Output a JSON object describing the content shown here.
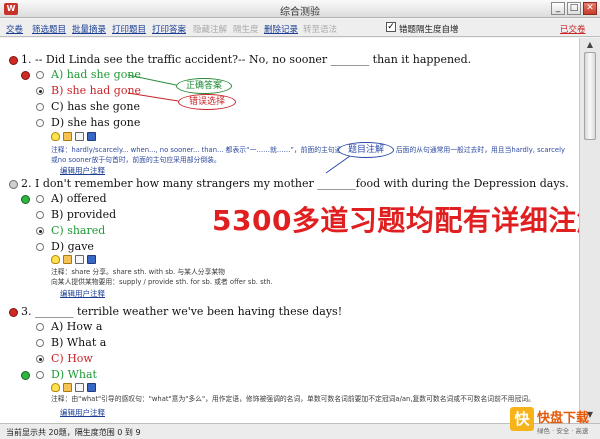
{
  "window": {
    "title": "综合测验",
    "app_icon": "W",
    "minimize": "_",
    "maximize": "□",
    "close": "✕"
  },
  "toolbar": {
    "items": [
      "交卷",
      "筛选题目",
      "批量摘录",
      "打印题目",
      "打印答案",
      "隐藏注解",
      "隔生度",
      "删除记录",
      "转至语法"
    ],
    "checkbox_label": "错题隔生度自增",
    "checkbox_mark": "✓",
    "exit": "已交卷"
  },
  "question1": {
    "text": "1. -- Did Linda see the traffic accident?-- No, no sooner _______ than it happened.",
    "options": [
      "A) had she gone",
      "B) she had gone",
      "C) has she gone",
      "D) she has gone"
    ],
    "note": "注释：hardly/scarcely... when..., no sooner... than... 都表示“一……就……”，前面的主句通常用过去完成时，后面的从句通常用一般过去时，用且当hardly, scarcely或no sooner放于句首时，前面的主句应采用部分倒装。",
    "edit_link": "编辑用户注释",
    "bubble_correct": "正确答案",
    "bubble_wrong": "错误选择",
    "bubble_note": "题目注解"
  },
  "question2": {
    "text": "2.  I don't remember how many strangers my mother _______food with during the Depression days.",
    "options": [
      "A) offered",
      "B) provided",
      "C) shared",
      "D) gave"
    ],
    "note1": "注释：share 分享。share sth. with sb. 与某人分享某物",
    "note2": "向某人提供某物要用：supply / provide sth. for sb. 或者  offer sb. sth.",
    "edit_link": "编辑用户注释"
  },
  "question3": {
    "text": "3.  _______ terrible weather we've been having these days!",
    "options": [
      "A) How a",
      "B) What a",
      "C) How",
      "D) What"
    ],
    "note": "注释：由\"what\"引导的感叹句：\"what\"意为\"多么\"，用作定语，修饰被强调的名词，单数可数名词前要加不定冠词a/an,复数可数名词或不可数名词前不用冠词。",
    "edit_link": "编辑用户注释"
  },
  "banner": "5300多道习题均配有详细注解！",
  "status": "当前显示共 20题，隔生度范围 0 到 9",
  "watermark": {
    "logo": "快",
    "name": "快盘下载",
    "tagline": "绿色 · 安全 · 高速"
  },
  "scroll": {
    "up": "▲",
    "down": "▼"
  }
}
